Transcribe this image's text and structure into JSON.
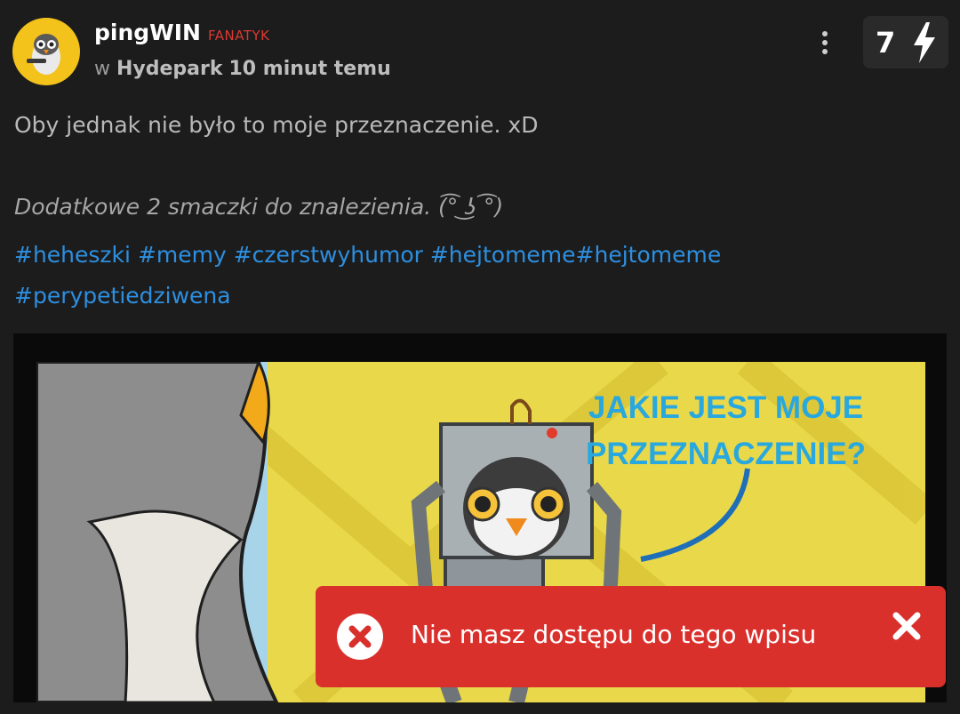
{
  "post": {
    "author": "pingWIN",
    "rank": "FANATYK",
    "meta_prefix": "w",
    "community": "Hydepark",
    "time": "10 minut temu",
    "votes": "7",
    "body": "Oby jednak nie było to moje przeznaczenie. xD",
    "extra": "Dodatkowe 2 smaczki do znalezienia. (͡° ͜ʖ ͡°)",
    "tags": [
      "#heheszki",
      "#memy",
      "#czerstwyhumor",
      "#hejtomeme",
      "#hejtomeme",
      "#perypetiedziwena"
    ]
  },
  "image": {
    "caption_line1": "JAKIE JEST MOJE",
    "caption_line2": "PRZEZNACZENIE?"
  },
  "toast": {
    "message": "Nie masz dostępu do tego wpisu"
  },
  "icons": {
    "more": "more-vertical-icon",
    "vote": "lightning-icon",
    "error": "error-x-circle-icon",
    "close": "close-icon"
  }
}
